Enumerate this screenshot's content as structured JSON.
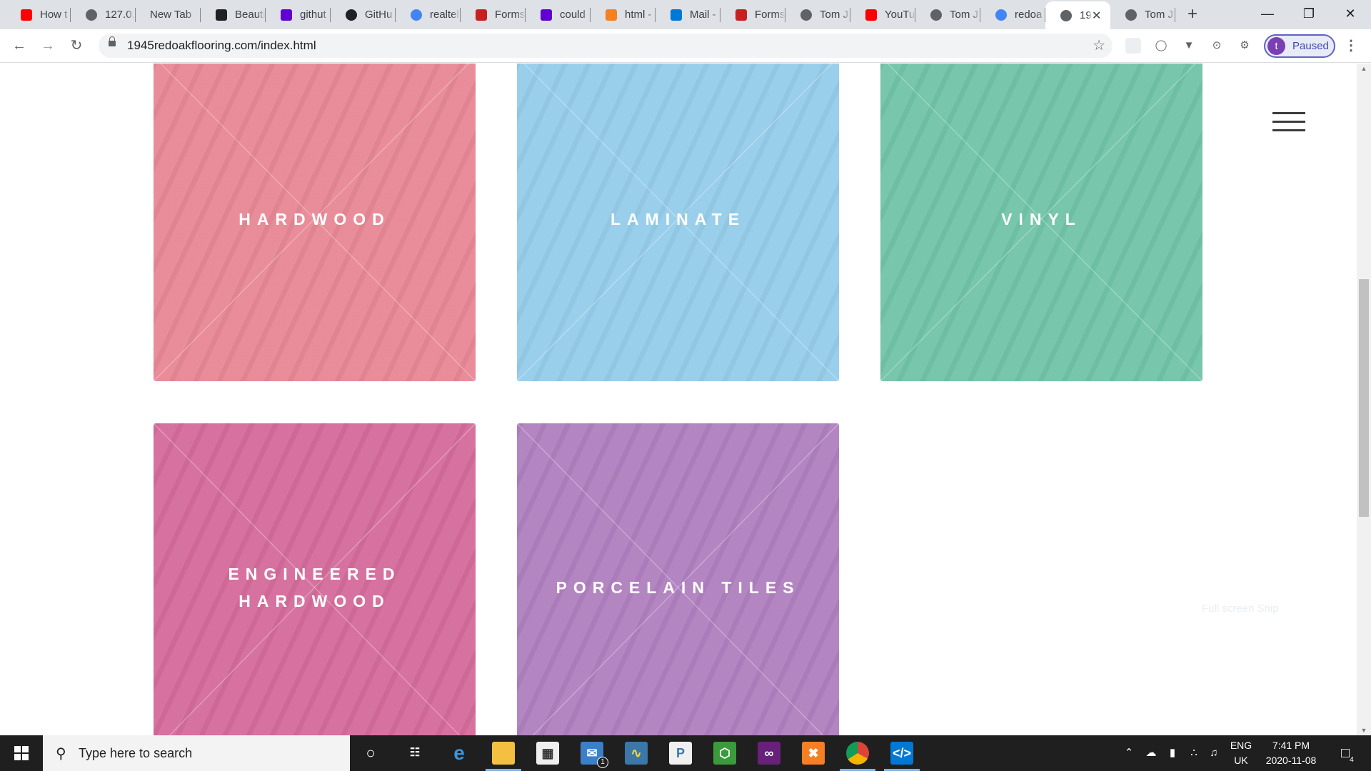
{
  "browser": {
    "tabs": [
      {
        "title": "How t",
        "icon": "youtube-icon",
        "color": "#ff0000"
      },
      {
        "title": "127.0.",
        "icon": "globe-icon",
        "color": "#5f6368"
      },
      {
        "title": "New Tab",
        "icon": "none",
        "color": "#5f6368"
      },
      {
        "title": "Beauti",
        "icon": "beautify-icon",
        "color": "#202124"
      },
      {
        "title": "githut",
        "icon": "yahoo-icon",
        "color": "#6001d2"
      },
      {
        "title": "GitHu",
        "icon": "github-icon",
        "color": "#202124"
      },
      {
        "title": "realtel",
        "icon": "google-icon",
        "color": "#4285f4"
      },
      {
        "title": "Forms",
        "icon": "forms-icon",
        "color": "#c5221f"
      },
      {
        "title": "could",
        "icon": "yahoo-icon",
        "color": "#6001d2"
      },
      {
        "title": "html -",
        "icon": "stackoverflow-icon",
        "color": "#f48024"
      },
      {
        "title": "Mail -",
        "icon": "outlook-icon",
        "color": "#0078d4"
      },
      {
        "title": "Forms",
        "icon": "forms-icon",
        "color": "#c5221f"
      },
      {
        "title": "Tom J",
        "icon": "globe-icon",
        "color": "#5f6368"
      },
      {
        "title": "YouTu",
        "icon": "youtube-icon",
        "color": "#ff0000"
      },
      {
        "title": "Tom J",
        "icon": "globe-icon",
        "color": "#5f6368"
      },
      {
        "title": "redoa",
        "icon": "google-icon",
        "color": "#4285f4"
      },
      {
        "title": "19",
        "icon": "globe-icon",
        "color": "#5f6368",
        "active": true
      },
      {
        "title": "Tom J",
        "icon": "globe-icon",
        "color": "#5f6368"
      }
    ],
    "url": "1945redoakflooring.com/index.html",
    "profile_initial": "t",
    "profile_status": "Paused"
  },
  "page": {
    "cards": [
      {
        "label": "HARDWOOD",
        "color": "#e88896"
      },
      {
        "label": "LAMINATE",
        "color": "#96cdea"
      },
      {
        "label": "VINYL",
        "color": "#72c4a8"
      },
      {
        "label": "ENGINEERED HARDWOOD",
        "color": "#d56c9c"
      },
      {
        "label": "PORCELAIN TILES",
        "color": "#b081c0"
      }
    ],
    "faint_text": "Full screen Snip"
  },
  "taskbar": {
    "search_placeholder": "Type here to search",
    "language_top": "ENG",
    "language_bottom": "UK",
    "time": "7:41 PM",
    "date": "2020-11-08",
    "mail_badge": "1",
    "notification_count": "4"
  }
}
